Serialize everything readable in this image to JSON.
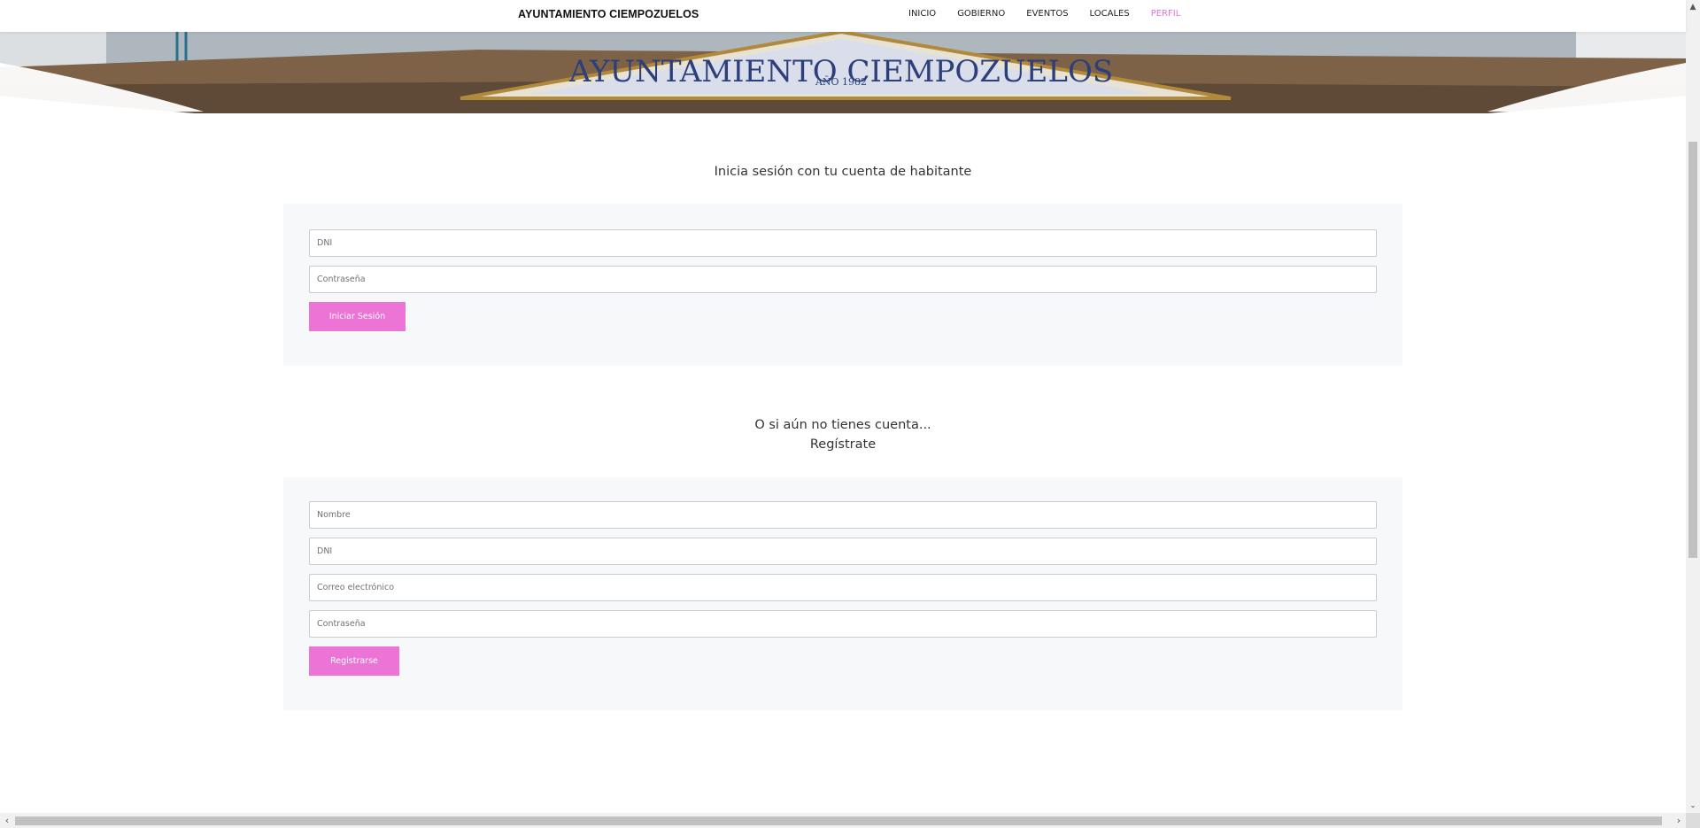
{
  "navbar": {
    "brand": "AYUNTAMIENTO CIEMPOZUELOS",
    "links": [
      {
        "label": "INICIO",
        "active": false
      },
      {
        "label": "GOBIERNO",
        "active": false
      },
      {
        "label": "EVENTOS",
        "active": false
      },
      {
        "label": "LOCALES",
        "active": false
      },
      {
        "label": "PERFIL",
        "active": true
      }
    ]
  },
  "hero": {
    "sign_text": "AYUNTAMIENTO CIEMPOZUELOS",
    "sign_year": "AÑO 1982"
  },
  "login": {
    "title": "Inicia sesión con tu cuenta de habitante",
    "dni_placeholder": "DNI",
    "password_placeholder": "Contraseña",
    "submit_label": "Iniciar Sesión"
  },
  "register": {
    "title_line1": "O si aún no tienes cuenta...",
    "title_line2": "Regístrate",
    "name_placeholder": "Nombre",
    "dni_placeholder": "DNI",
    "email_placeholder": "Correo electrónico",
    "password_placeholder": "Contraseña",
    "submit_label": "Registrarse"
  },
  "colors": {
    "accent": "#eb74d6",
    "panel_bg": "#f7f8fa"
  }
}
